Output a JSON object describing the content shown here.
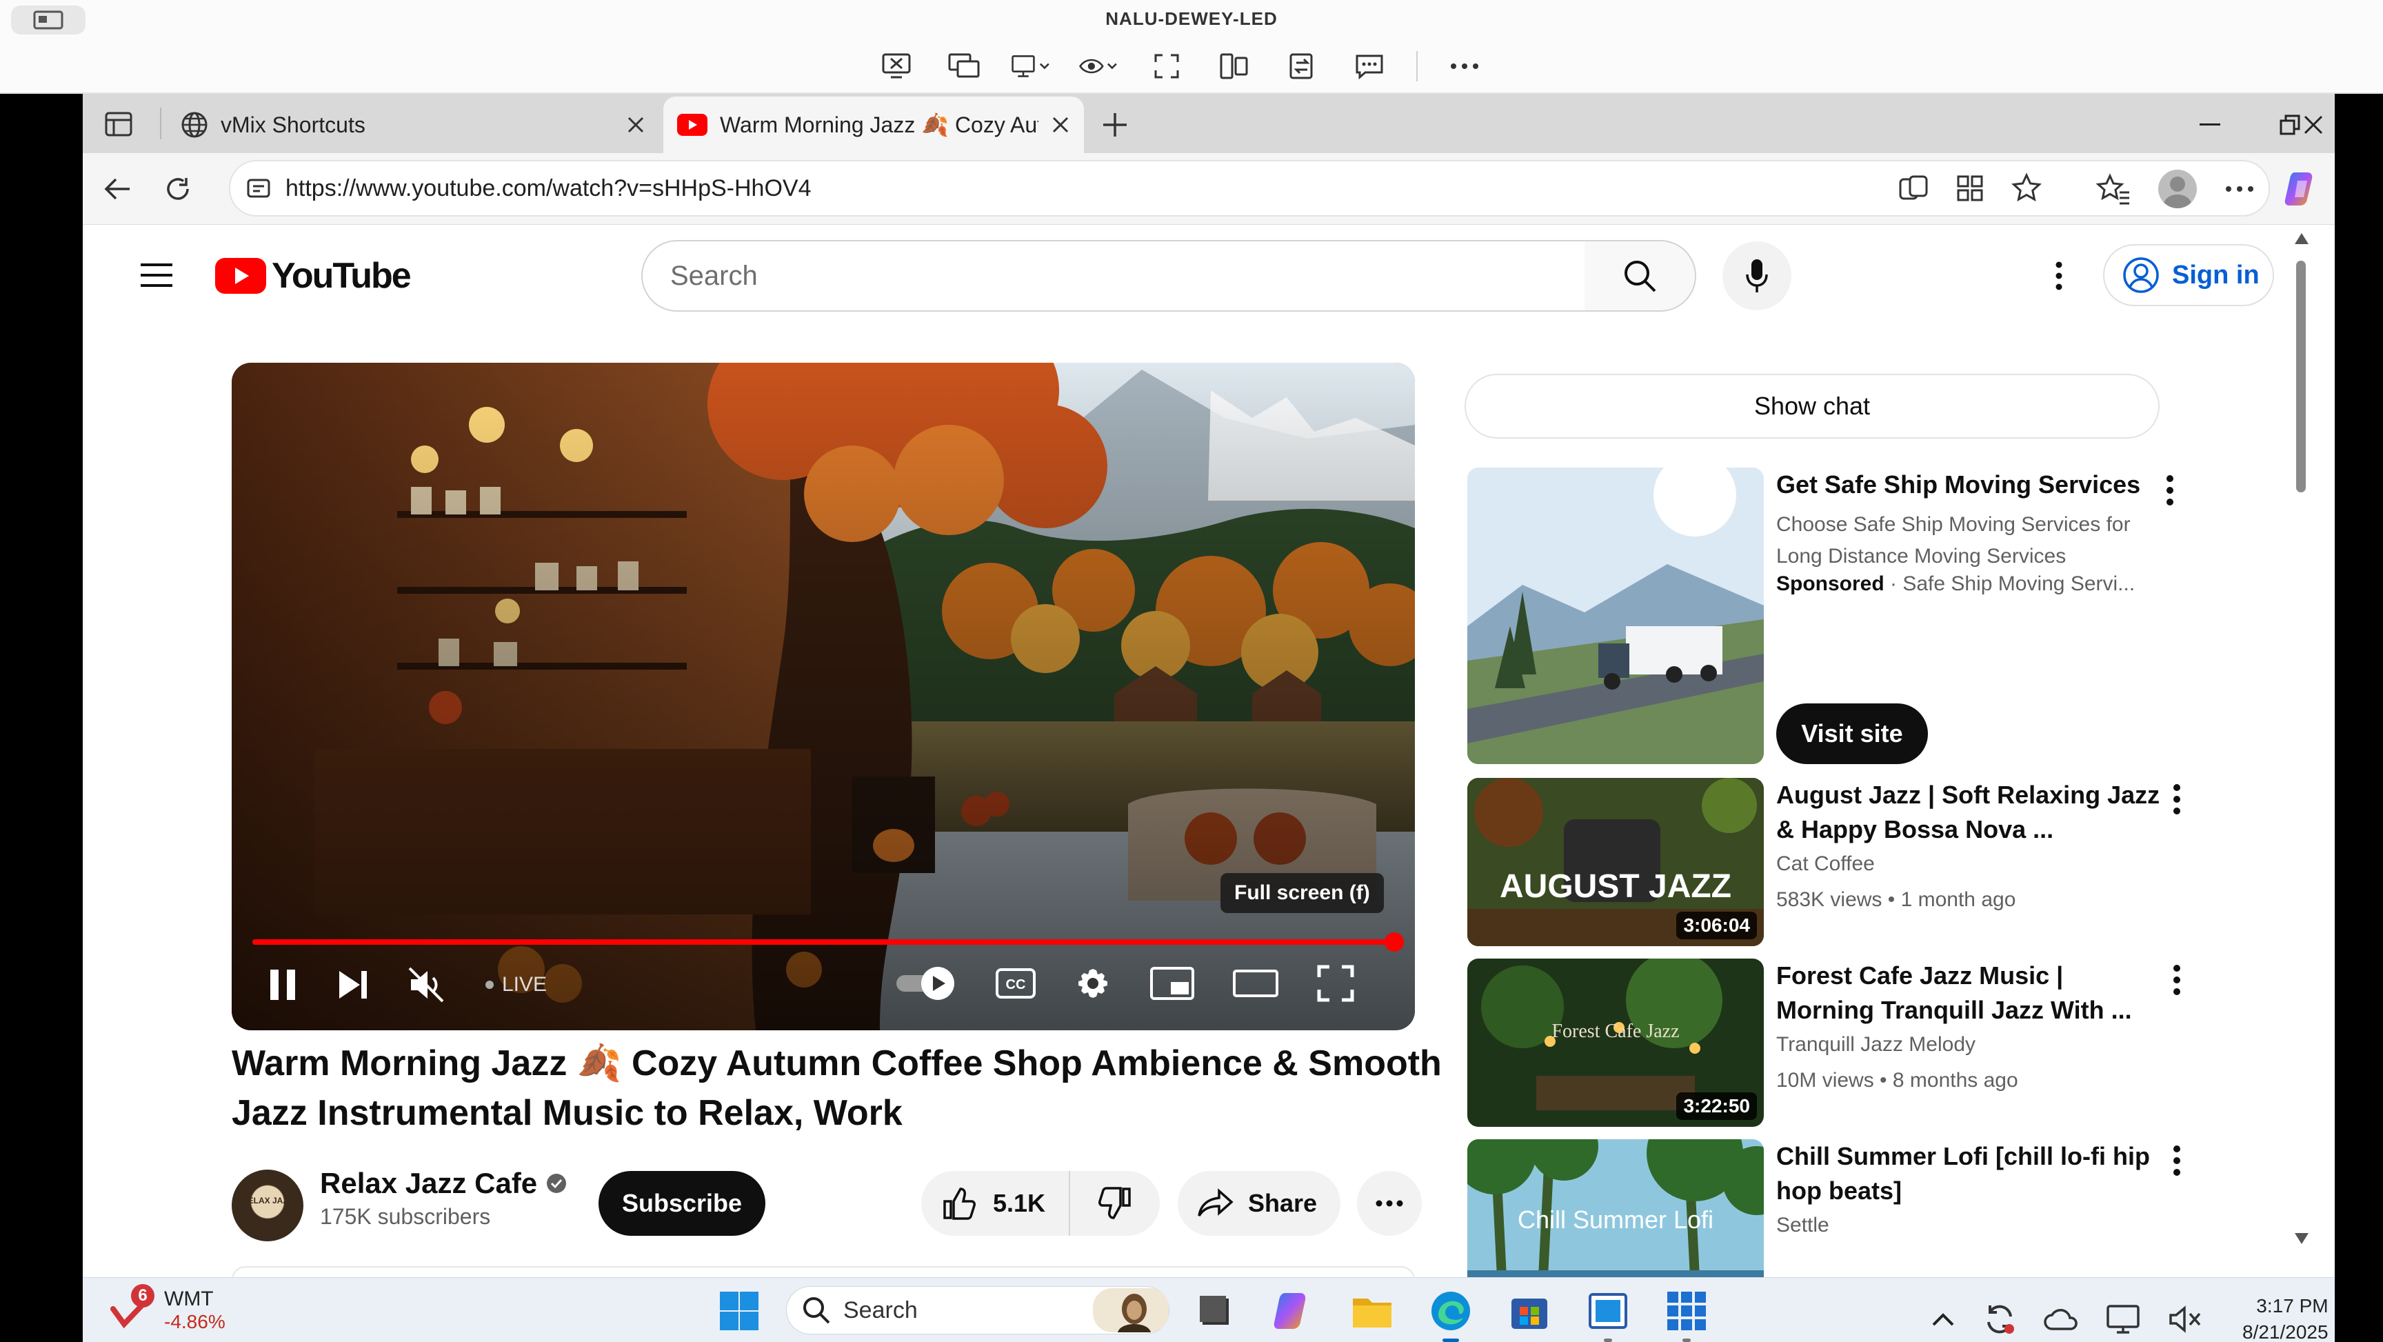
{
  "remote_desktop": {
    "title": "NALU-DEWEY-LED",
    "tools": [
      "ctrl-alt-del-icon",
      "switch-monitor-icon",
      "display-icon",
      "eye-icon",
      "fullscreen-icon",
      "device-icon",
      "transfer-icon",
      "chat-icon",
      "more-icon"
    ]
  },
  "browser": {
    "tabs": [
      {
        "title": "vMix Shortcuts",
        "icon": "globe-icon"
      },
      {
        "title": "Warm Morning Jazz 🍂 Cozy Aut",
        "icon": "youtube-icon"
      }
    ],
    "url": "https://www.youtube.com/watch?v=sHHpS-HhOV4"
  },
  "youtube": {
    "logo": "YouTube",
    "search_placeholder": "Search",
    "sign_in": "Sign in",
    "show_chat": "Show chat",
    "player": {
      "tooltip": "Full screen (f)",
      "live_label": "LIVE",
      "progress": 1.0
    },
    "video_title": "Warm Morning Jazz 🍂 Cozy Autumn Coffee Shop Ambience & Smooth Jazz Instrumental Music to Relax, Work",
    "channel": {
      "name": "Relax Jazz Cafe",
      "subscribers": "175K subscribers",
      "avatar_text": "RELAX JAZZ"
    },
    "subscribe": "Subscribe",
    "likes": "5.1K",
    "share": "Share",
    "recommendations": [
      {
        "title": "Get Safe Ship Moving Services",
        "desc": "Choose Safe Ship Moving Services for Long Distance Moving Services",
        "sponsored": "Sponsored",
        "advertiser": "· Safe Ship Moving Servi...",
        "cta": "Visit site"
      },
      {
        "title": "August Jazz | Soft Relaxing Jazz & Happy Bossa Nova ...",
        "channel": "Cat Coffee",
        "meta": "583K views • 1 month ago",
        "duration": "3:06:04",
        "thumb_text": "AUGUST JAZZ"
      },
      {
        "title": "Forest Cafe Jazz Music | Morning Tranquill Jazz With ...",
        "channel": "Tranquill Jazz Melody",
        "meta": "10M views • 8 months ago",
        "duration": "3:22:50",
        "thumb_text": "Forest Cafe Jazz"
      },
      {
        "title": "Chill Summer Lofi [chill lo-fi hip hop beats]",
        "channel": "Settle",
        "thumb_text": "Chill Summer Lofi"
      }
    ]
  },
  "taskbar": {
    "stock_ticker": "WMT",
    "stock_change": "-4.86%",
    "badge": "6",
    "search": "Search",
    "time": "3:17 PM",
    "date": "8/21/2025"
  }
}
